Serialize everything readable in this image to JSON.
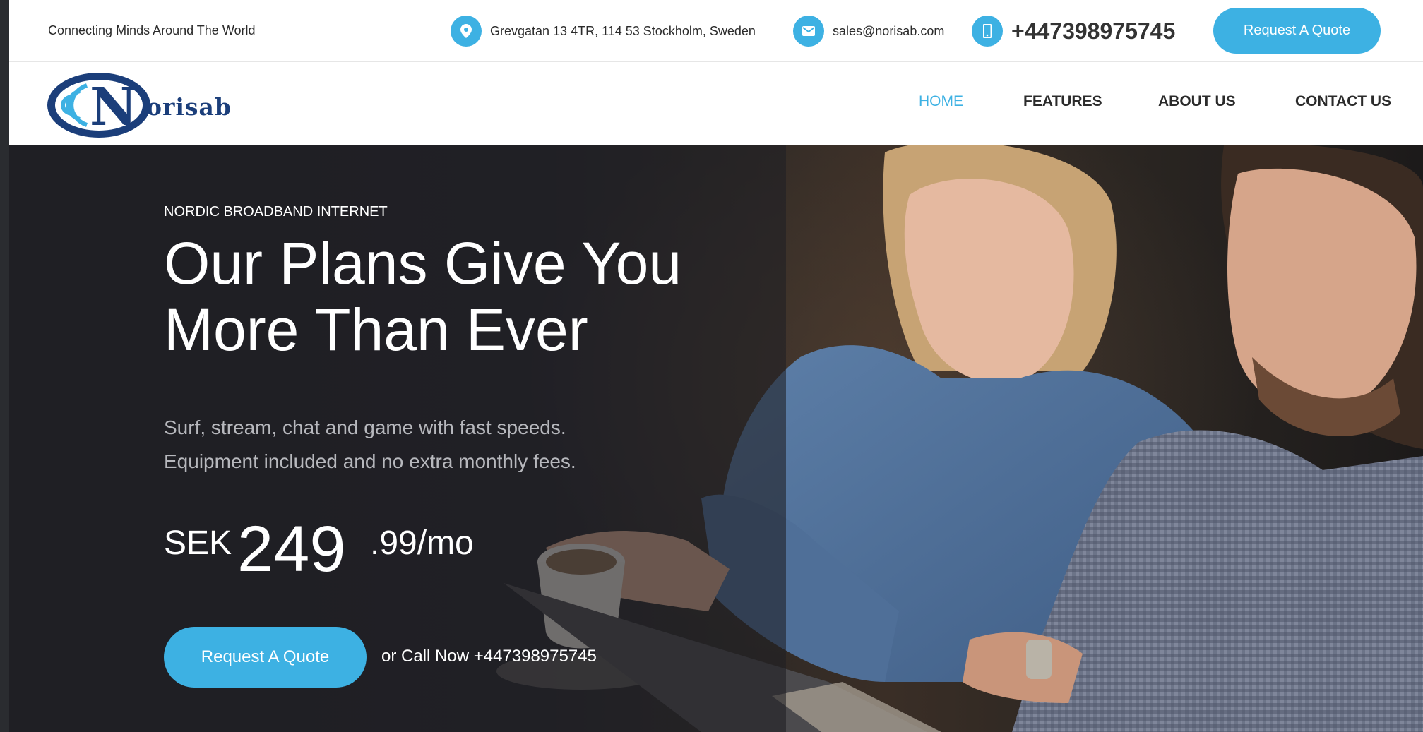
{
  "topbar": {
    "tagline": "Connecting Minds Around The World",
    "address": "Grevgatan 13 4TR, 114 53 Stockholm, Sweden",
    "email": "sales@norisab.com",
    "phone": "+447398975745",
    "quote_button": "Request A Quote"
  },
  "brand": {
    "logo_text": "orisab",
    "logo_letter": "N",
    "color_primary": "#1b3e7a",
    "color_accent": "#3db1e3"
  },
  "nav": {
    "items": [
      {
        "label": "HOME",
        "active": true
      },
      {
        "label": "FEATURES",
        "active": false
      },
      {
        "label": "ABOUT US",
        "active": false
      },
      {
        "label": "CONTACT US",
        "active": false
      }
    ]
  },
  "hero": {
    "eyebrow": "NORDIC BROADBAND INTERNET",
    "headline_line1": "Our Plans Give You",
    "headline_line2": "More Than Ever",
    "subtitle_line1": "Surf, stream, chat and game with fast speeds.",
    "subtitle_line2": "Equipment included and no extra monthly fees.",
    "price_currency": "SEK",
    "price_integer": "249",
    "price_decimal": ".99/mo",
    "cta_button": "Request A Quote",
    "call_text": "or Call Now +447398975745",
    "image": "photo of a smiling woman in denim shirt holding coffee and a bearded man in checkered shirt looking at a laptop"
  },
  "icons": {
    "address": "map-pin-icon",
    "email": "envelope-icon",
    "phone": "mobile-phone-icon"
  }
}
